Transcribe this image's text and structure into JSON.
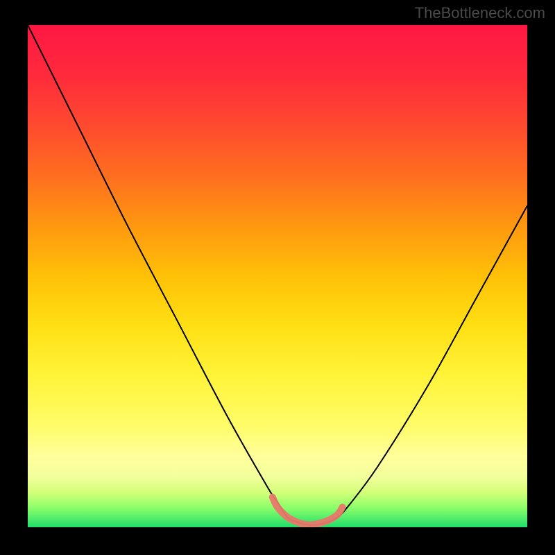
{
  "watermark": "TheBottleneck.com",
  "chart_data": {
    "type": "line",
    "title": "",
    "xlabel": "",
    "ylabel": "",
    "xlim": [
      0,
      100
    ],
    "ylim": [
      0,
      100
    ],
    "grid": false,
    "series": [
      {
        "name": "curve",
        "x": [
          0,
          10,
          20,
          30,
          40,
          48,
          50,
          52,
          54,
          56,
          58,
          60,
          62,
          64,
          70,
          80,
          90,
          100
        ],
        "y": [
          100,
          80,
          60,
          41,
          22,
          8,
          5,
          2,
          1,
          0.5,
          0.5,
          1,
          2,
          4,
          12,
          28,
          46,
          64
        ]
      },
      {
        "name": "flat-bottom-highlight",
        "x": [
          49,
          50,
          52,
          54,
          56,
          58,
          60,
          62,
          63
        ],
        "y": [
          6,
          4,
          2,
          1,
          0.5,
          0.7,
          1.3,
          2.5,
          4
        ]
      }
    ],
    "gradient_stops": [
      {
        "offset": 0.0,
        "color": "#ff1744"
      },
      {
        "offset": 0.1,
        "color": "#ff2a3c"
      },
      {
        "offset": 0.2,
        "color": "#ff4a2f"
      },
      {
        "offset": 0.3,
        "color": "#ff6e1f"
      },
      {
        "offset": 0.4,
        "color": "#ff9810"
      },
      {
        "offset": 0.5,
        "color": "#ffc107"
      },
      {
        "offset": 0.6,
        "color": "#ffe014"
      },
      {
        "offset": 0.7,
        "color": "#fff43a"
      },
      {
        "offset": 0.8,
        "color": "#fffc6a"
      },
      {
        "offset": 0.86,
        "color": "#ffff9c"
      },
      {
        "offset": 0.9,
        "color": "#f2ff9c"
      },
      {
        "offset": 0.93,
        "color": "#d4ff7a"
      },
      {
        "offset": 0.96,
        "color": "#8fff6a"
      },
      {
        "offset": 1.0,
        "color": "#1fdd6a"
      }
    ],
    "curve_stroke": "#000000",
    "highlight_stroke": "#e8786b",
    "highlight_width": 10
  }
}
